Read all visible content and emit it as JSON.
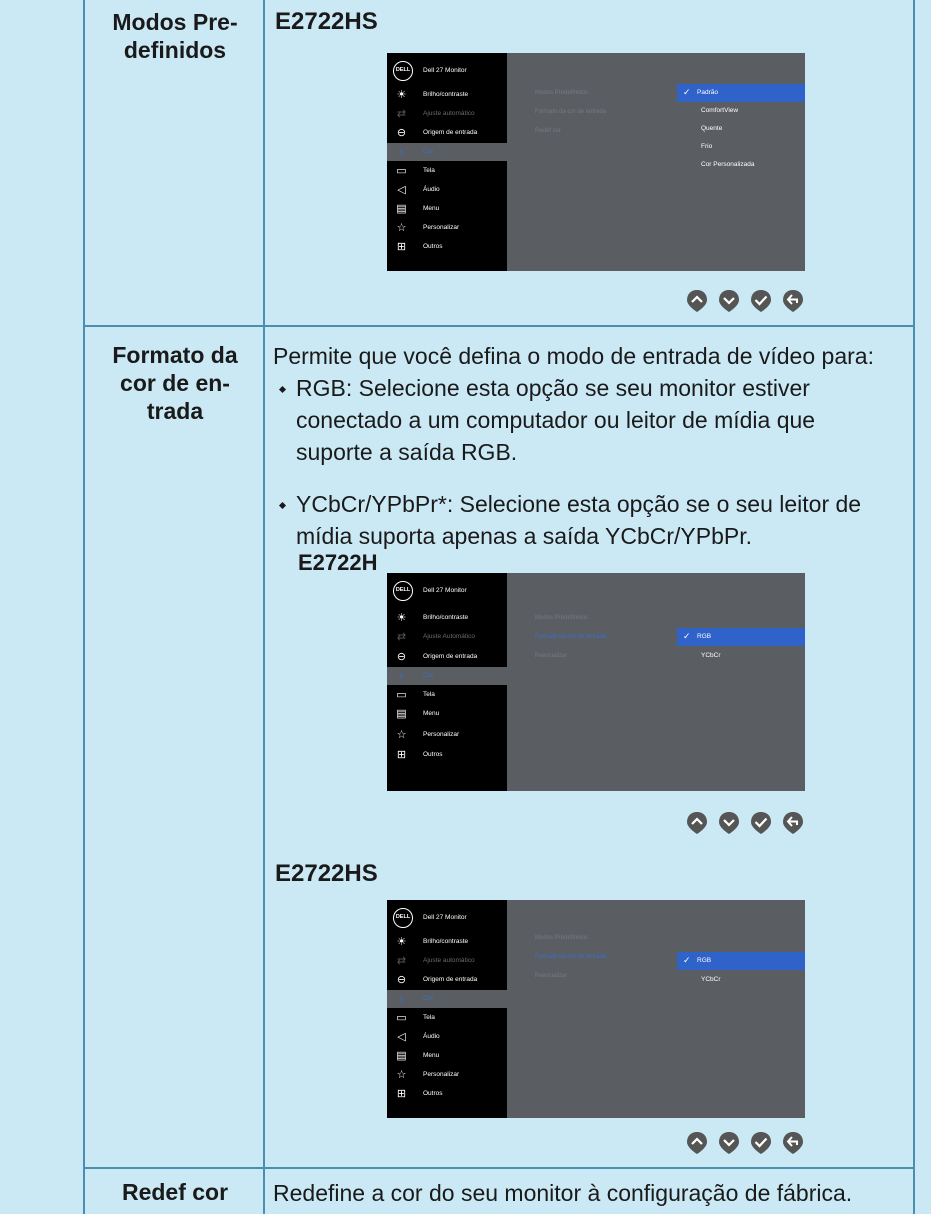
{
  "rows": [
    {
      "label": "Modos Pre-\ndefinidos"
    },
    {
      "label": "Formato da\ncor de en-\ntrada"
    },
    {
      "label": "Redef cor"
    }
  ],
  "section1": {
    "heading": "E2722HS"
  },
  "section2": {
    "intro": "Permite que você defina o modo de entrada de vídeo para:",
    "bullets": [
      {
        "title": "RGB:",
        "text": " Selecione esta opção se seu monitor estiver",
        "lines": [
          "conectado a um computador ou leitor de mídia que",
          "suporte a saída RGB."
        ]
      },
      {
        "title": "YCbCr/YPbPr*:",
        "text": " Selecione esta opção se o seu leitor de",
        "lines": [
          "mídia suporta apenas a saída YCbCr/YPbPr."
        ]
      }
    ],
    "heading_h": "E2722H",
    "heading_hs": "E2722HS"
  },
  "section3": {
    "text": "Redefine a cor do seu monitor à configuração de fábrica."
  },
  "osd1": {
    "logo": "DELL",
    "model": "Dell 27 Monitor",
    "menu": [
      "Brilho/contraste",
      "Ajuste automático",
      "Origem de entrada",
      "Cor",
      "Tela",
      "Áudio",
      "Menu",
      "Personalizar",
      "Outros"
    ],
    "sub": [
      "Modos Predefinidos",
      "Formato da cor de entrada",
      "Redef cor"
    ],
    "options": [
      "Padrão",
      "ComfortView",
      "Quente",
      "Frio",
      "Cor Personalizada"
    ]
  },
  "osd2": {
    "logo": "DELL",
    "model": "Dell 27 Monitor",
    "menu": [
      "Brilho/contraste",
      "Ajuste Automático",
      "Origem de entrada",
      "Cor",
      "Tela",
      "Menu",
      "Personalizar",
      "Outros"
    ],
    "sub": [
      "Modos Predefinidos",
      "Formato da cor de entrada",
      "Reinicializar"
    ],
    "options": [
      "RGB",
      "YCbCr"
    ]
  },
  "osd3": {
    "logo": "DELL",
    "model": "Dell 27 Monitor",
    "menu": [
      "Brilho/contraste",
      "Ajuste automático",
      "Origem de entrada",
      "Cor",
      "Tela",
      "Áudio",
      "Menu",
      "Personalizar",
      "Outros"
    ],
    "sub": [
      "Modos Predefinidos",
      "Formato da cor de entrada",
      "Reinicializar"
    ],
    "options": [
      "RGB",
      "YCbCr"
    ]
  },
  "icons": {
    "nav": [
      "nav-up-icon",
      "nav-down-icon",
      "nav-ok-icon",
      "nav-back-icon"
    ],
    "menu1": [
      "brightness-icon",
      "auto-adjust-icon",
      "input-source-icon",
      "color-icon",
      "display-icon",
      "audio-icon",
      "menu-icon",
      "personalize-icon",
      "others-icon"
    ],
    "menu2": [
      "brightness-icon",
      "auto-adjust-icon",
      "input-source-icon",
      "color-icon",
      "display-icon",
      "menu-icon",
      "personalize-icon",
      "others-icon"
    ]
  },
  "colors": {
    "background": "#cbe9f5",
    "grid": "#4a8fb0",
    "osd_panel": "#5a5d62",
    "highlight": "#2f63c9"
  }
}
